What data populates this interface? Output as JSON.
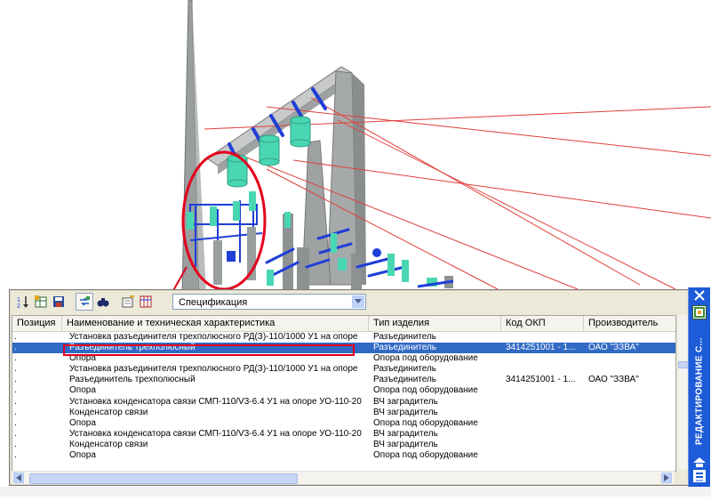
{
  "palette": {
    "spec_select_value": "Спецификация",
    "side_title": "РЕДАКТИРОВАНИЕ С...",
    "toolbar_icons": [
      "sort-icon",
      "table-icon",
      "save-icon",
      "link-icon",
      "binoculars-icon",
      "edit-icon",
      "columns-icon"
    ]
  },
  "grid": {
    "columns": [
      "Позиция",
      "Наименование и техническая характеристика",
      "Тип изделия",
      "Код ОКП",
      "Производитель"
    ],
    "rows": [
      {
        "marker": ".",
        "name": "Установка разъединителя трехполюсного РД(З)-110/1000 У1 на опоре",
        "type": "Разъединитель",
        "code": "",
        "maker": "",
        "selected": false
      },
      {
        "marker": ".",
        "name": "Разъединитель трехполюсный",
        "type": "Разъединитель",
        "code": "3414251001 - 1...",
        "maker": "ОАО \"ЗЗВА\"",
        "selected": true
      },
      {
        "marker": ".",
        "name": "Опора",
        "type": "Опора под оборудование",
        "code": "",
        "maker": "",
        "selected": false
      },
      {
        "marker": ".",
        "name": "Установка разъединителя трехполюсного РД(З)-110/1000 У1 на опоре",
        "type": "Разъединитель",
        "code": "",
        "maker": "",
        "selected": false
      },
      {
        "marker": ".",
        "name": "Разъединитель трехполюсный",
        "type": "Разъединитель",
        "code": "3414251001 - 1...",
        "maker": "ОАО \"ЗЗВА\"",
        "selected": false
      },
      {
        "marker": ".",
        "name": "Опора",
        "type": "Опора под оборудование",
        "code": "",
        "maker": "",
        "selected": false
      },
      {
        "marker": ".",
        "name": "Установка конденсатора связи СМП-110/V3-6.4 У1 на опоре УО-110-20",
        "type": "ВЧ заградитель",
        "code": "",
        "maker": "",
        "selected": false
      },
      {
        "marker": ".",
        "name": "Конденсатор связи",
        "type": "ВЧ заградитель",
        "code": "",
        "maker": "",
        "selected": false
      },
      {
        "marker": ".",
        "name": "Опора",
        "type": "Опора под оборудование",
        "code": "",
        "maker": "",
        "selected": false
      },
      {
        "marker": ".",
        "name": "Установка конденсатора связи СМП-110/V3-6.4 У1 на опоре УО-110-20",
        "type": "ВЧ заградитель",
        "code": "",
        "maker": "",
        "selected": false
      },
      {
        "marker": ".",
        "name": "Конденсатор связи",
        "type": "ВЧ заградитель",
        "code": "",
        "maker": "",
        "selected": false
      },
      {
        "marker": ".",
        "name": "Опора",
        "type": "Опора под оборудование",
        "code": "",
        "maker": "",
        "selected": false
      }
    ]
  },
  "colors": {
    "selection": "#316ac5",
    "annotation_red": "#e3001b",
    "equipment_cyan": "#49d6b3",
    "equipment_blue": "#1f3fd6",
    "steel_gray": "#8e9293",
    "side_strip": "#1d5bd8"
  }
}
